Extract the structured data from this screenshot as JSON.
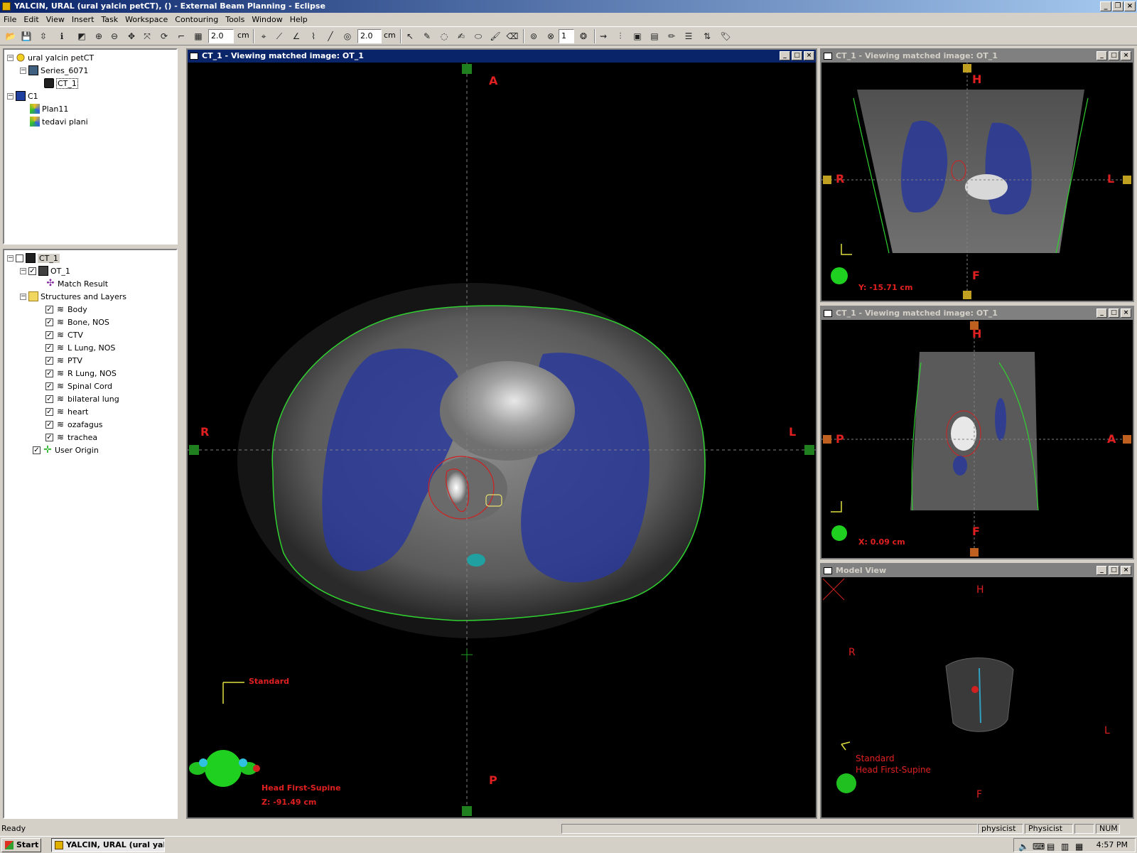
{
  "window": {
    "title": "YALCIN, URAL (ural yalcin petCT), () - External Beam Planning - Eclipse",
    "minimize": "_",
    "restore": "❐",
    "close": "×"
  },
  "menu": [
    "File",
    "Edit",
    "View",
    "Insert",
    "Task",
    "Workspace",
    "Contouring",
    "Tools",
    "Window",
    "Help"
  ],
  "toolbar": {
    "field1": "2.0",
    "unit1": "cm",
    "field2": "2.0",
    "unit2": "cm",
    "field3": "1"
  },
  "patient_tree": {
    "root": "ural yalcin petCT",
    "series": "Series_6071",
    "image": "CT_1",
    "course": "C1",
    "plans": [
      "Plan11",
      "tedavi plani"
    ]
  },
  "structure_tree": {
    "root": "CT_1",
    "registered": "OT_1",
    "match": "Match Result",
    "folder": "Structures and Layers",
    "structures": [
      "Body",
      "Bone, NOS",
      "CTV",
      "L Lung, NOS",
      "PTV",
      "R Lung, NOS",
      "Spinal Cord",
      "bilateral lung",
      "heart",
      "ozafagus",
      "trachea"
    ],
    "origin": "User Origin"
  },
  "views": {
    "axial": {
      "title": "CT_1  -  Viewing matched image: OT_1",
      "top": "A",
      "bottom": "P",
      "left": "R",
      "right": "L",
      "orientation": "Standard",
      "position": "Head First-Supine",
      "coord": "Z: -91.49 cm"
    },
    "coronal": {
      "title": "CT_1  -  Viewing matched image: OT_1",
      "top": "H",
      "bottom": "F",
      "left": "R",
      "right": "L",
      "coord": "Y: -15.71 cm"
    },
    "sagittal": {
      "title": "CT_1  -  Viewing matched image: OT_1",
      "top": "H",
      "bottom": "F",
      "left": "P",
      "right": "A",
      "coord": "X: 0.09 cm"
    },
    "model": {
      "title": "Model View",
      "top": "H",
      "bottom": "F",
      "left": "R",
      "right": "L",
      "orientation": "Standard",
      "position": "Head First-Supine"
    }
  },
  "status": {
    "text": "Ready",
    "user1": "physicist",
    "user2": "Physicist",
    "num": "NUM"
  },
  "taskbar": {
    "start": "Start",
    "task": "YALCIN, URAL (ural yal...",
    "clock": "4:57 PM"
  },
  "colors": {
    "lung": "#2a3a9a",
    "body_contour": "#30d030",
    "ptv": "#d02020",
    "label_red": "#e02020"
  }
}
